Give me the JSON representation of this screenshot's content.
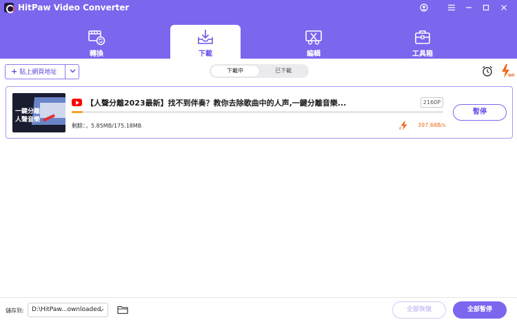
{
  "window": {
    "title": "HitPaw Video Converter"
  },
  "tabs": [
    {
      "label": "轉換",
      "icon": "film-convert-icon"
    },
    {
      "label": "下載",
      "icon": "download-tray-icon"
    },
    {
      "label": "編輯",
      "icon": "scissors-edit-icon"
    },
    {
      "label": "工具箱",
      "icon": "toolbox-icon"
    }
  ],
  "active_tab": "下載",
  "toolbar": {
    "paste_label": "貼上網頁地址",
    "segments": [
      "下載中",
      "已下載"
    ],
    "active_segment": "下載中"
  },
  "download": {
    "title": "【人聲分離2023最新】找不到伴奏？教你去除歌曲中的人声,一鍵分離音樂...",
    "thumb_text": [
      "一鍵分離",
      "人聲音樂"
    ],
    "resolution": "2160P",
    "progress_fraction": 0.03,
    "remaining": "剩餘：，5.85MB/175.18MB",
    "speed": "397.68B/s",
    "pause_label": "暫停"
  },
  "bottom": {
    "save_label": "儲存到:",
    "path": "D:\\HitPaw...ownloaded",
    "resume_all_label": "全部恢復",
    "pause_all_label": "全部暫停"
  },
  "colors": {
    "accent": "#7b66ee",
    "progress": "#f4a020",
    "speed": "#f06a1a"
  }
}
